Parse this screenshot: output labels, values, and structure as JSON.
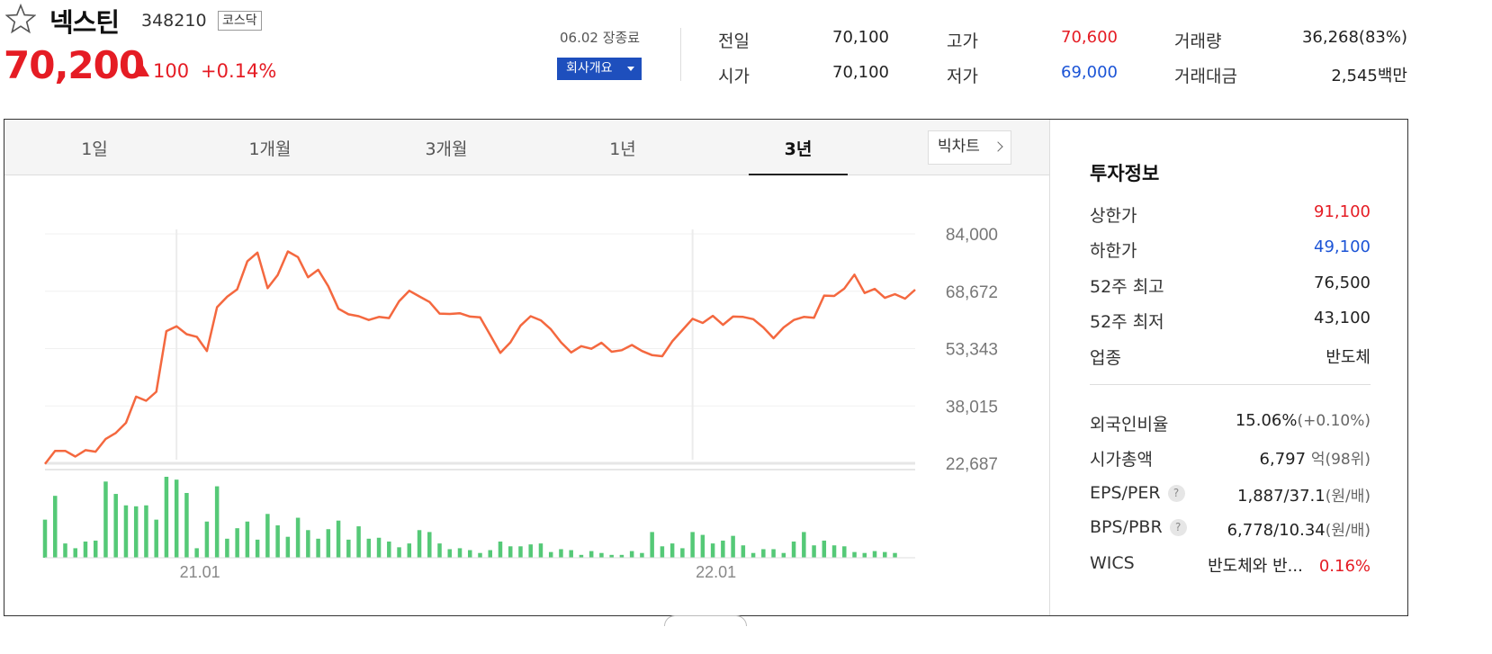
{
  "stock": {
    "name": "넥스틴",
    "code": "348210",
    "market": "코스닥",
    "price": "70,200",
    "change": "100",
    "change_pct": "+0.14%",
    "date_status": "06.02 장종료",
    "corp_button": "회사개요"
  },
  "quote": {
    "prev_label": "전일",
    "prev": "70,100",
    "open_label": "시가",
    "open": "70,100",
    "high_label": "고가",
    "high": "70,600",
    "low_label": "저가",
    "low": "69,000",
    "volume_label": "거래량",
    "volume": "36,268(83%)",
    "amount_label": "거래대금",
    "amount": "2,545",
    "amount_unit": "백만"
  },
  "tabs": [
    {
      "label": "1일"
    },
    {
      "label": "1개월"
    },
    {
      "label": "3개월"
    },
    {
      "label": "1년"
    },
    {
      "label": "3년"
    }
  ],
  "active_tab": "3년",
  "big_chart_label": "빅차트",
  "colors": {
    "up": "#e51c24",
    "down": "#1c54d6",
    "line": "#f4683f",
    "volume": "#55c977",
    "accent": "#1e4fbd"
  },
  "chart_data": {
    "type": "line",
    "ylim": [
      22687,
      84000
    ],
    "yticks": [
      "84,000",
      "68,672",
      "53,343",
      "38,015",
      "22,687"
    ],
    "xticks": [
      "21.01",
      "22.01"
    ],
    "x": [
      0,
      1,
      2,
      3,
      4,
      5,
      6,
      7,
      8,
      9,
      10,
      11,
      12,
      13,
      14,
      15,
      16,
      17,
      18,
      19,
      20,
      21,
      22,
      23,
      24,
      25,
      26,
      27,
      28,
      29,
      30,
      31,
      32,
      33,
      34,
      35,
      36,
      37,
      38,
      39,
      40,
      41,
      42,
      43,
      44,
      45,
      46,
      47,
      48,
      49,
      50,
      51,
      52,
      53,
      54,
      55,
      56,
      57,
      58,
      59,
      60,
      61,
      62,
      63,
      64,
      65,
      66,
      67,
      68,
      69,
      70,
      71,
      72,
      73,
      74,
      75,
      76,
      77,
      78,
      79,
      80,
      81,
      82,
      83,
      84
    ],
    "xtick_index": [
      13,
      64
    ],
    "values": [
      22500,
      26000,
      26000,
      24500,
      26200,
      25800,
      29200,
      30800,
      33500,
      40500,
      39400,
      41800,
      58000,
      59300,
      57200,
      56500,
      52700,
      64400,
      67200,
      69200,
      76700,
      79000,
      69500,
      73000,
      79300,
      77800,
      72400,
      74400,
      70000,
      64000,
      62500,
      62000,
      61000,
      61800,
      61500,
      66000,
      68800,
      67300,
      65800,
      62700,
      62600,
      62800,
      61900,
      61700,
      57000,
      52200,
      55000,
      59500,
      62000,
      60900,
      58500,
      55000,
      52300,
      54000,
      53300,
      54900,
      52500,
      52900,
      54300,
      52700,
      51600,
      51300,
      55300,
      58300,
      61300,
      60200,
      62100,
      59700,
      61900,
      61800,
      61200,
      59000,
      56100,
      59000,
      61000,
      61800,
      61600,
      67500,
      67400,
      69400,
      73100,
      68200,
      69300,
      66900,
      67900,
      66700,
      69100
    ],
    "volume": [
      40,
      65,
      15,
      10,
      17,
      18,
      80,
      67,
      55,
      54,
      55,
      40,
      85,
      82,
      68,
      10,
      38,
      75,
      20,
      31,
      38,
      19,
      46,
      34,
      22,
      42,
      29,
      20,
      30,
      39,
      19,
      33,
      20,
      21,
      17,
      11,
      15,
      29,
      27,
      15,
      9,
      10,
      8,
      5,
      8,
      17,
      12,
      12,
      14,
      15,
      6,
      9,
      8,
      3,
      7,
      5,
      3,
      3,
      7,
      5,
      27,
      12,
      15,
      10,
      27,
      24,
      15,
      18,
      23,
      13,
      5,
      9,
      9,
      5,
      17,
      27,
      13,
      18,
      13,
      12,
      6,
      5,
      7,
      6,
      5
    ]
  },
  "invest": {
    "title": "투자정보",
    "upper_label": "상한가",
    "upper": "91,100",
    "lower_label": "하한가",
    "lower": "49,100",
    "high52_label": "52주 최고",
    "high52": "76,500",
    "low52_label": "52주 최저",
    "low52": "43,100",
    "sector_label": "업종",
    "sector": "반도체",
    "foreign_label": "외국인비율",
    "foreign": "15.06%",
    "foreign_chg": "(+0.10%)",
    "mcap_label": "시가총액",
    "mcap": "6,797",
    "mcap_unit": "억",
    "mcap_rank": "(98위)",
    "eps_label": "EPS/PER",
    "eps": "1,887/37.1",
    "eps_unit": "(원/배)",
    "bps_label": "BPS/PBR",
    "bps": "6,778/10.34",
    "bps_unit": "(원/배)",
    "wics_label": "WICS",
    "wics": "반도체와 반...",
    "wics_pct": "0.16%",
    "help_glyph": "?"
  }
}
